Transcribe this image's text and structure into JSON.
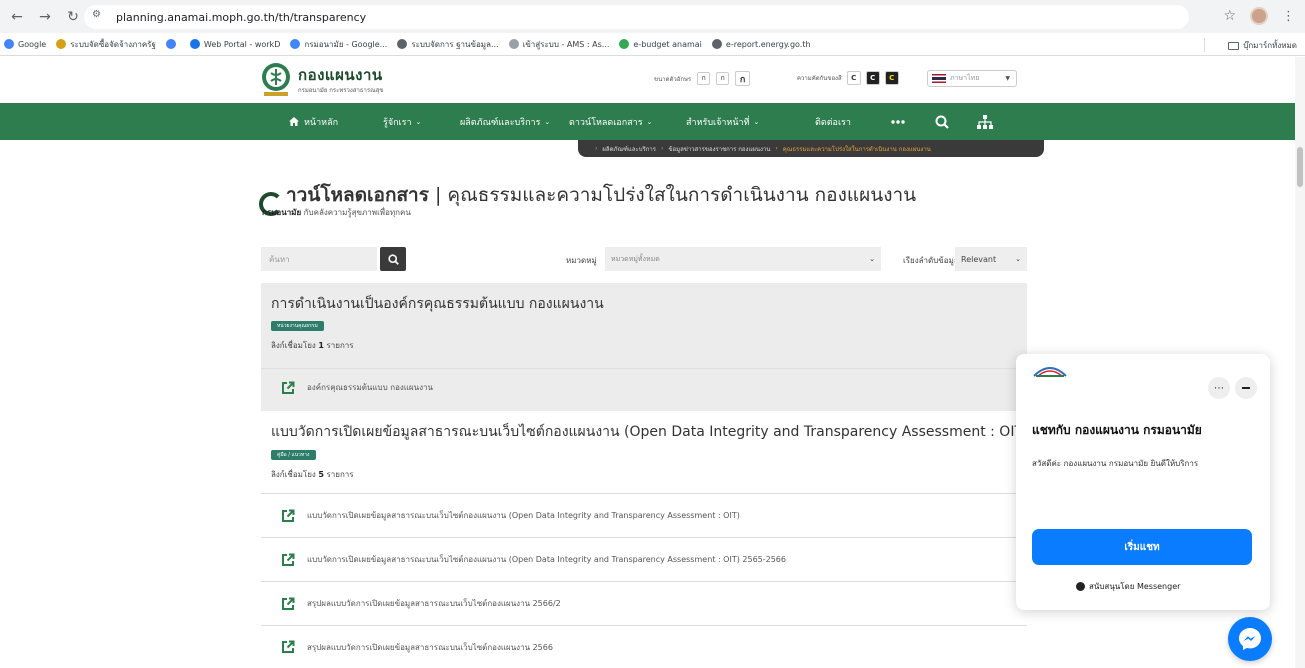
{
  "browser": {
    "url": "planning.anamai.moph.go.th/th/transparency",
    "bookmarks": [
      {
        "label": "Google",
        "color": "#4285f4"
      },
      {
        "label": "ระบบจัดซื้อจัดจ้างภาครัฐ",
        "color": "#d4a017"
      },
      {
        "label": "",
        "color": "#4285f4"
      },
      {
        "label": "Web Portal - workD",
        "color": "#1a73e8"
      },
      {
        "label": "กรมอนามัย - Google...",
        "color": "#4285f4"
      },
      {
        "label": "ระบบจัดการ ฐานข้อมูล...",
        "color": "#5f6368"
      },
      {
        "label": "เข้าสู่ระบบ - AMS : As...",
        "color": "#9aa0a6"
      },
      {
        "label": "e-budget anamai",
        "color": "#34a853"
      },
      {
        "label": "e-report.energy.go.th",
        "color": "#5f6368"
      }
    ],
    "bookmarks_right": "บุ๊กมาร์กทั้งหมด"
  },
  "header": {
    "logo_title": "กองแผนงาน",
    "logo_sub": "กรมอนามัย กระทรวงสาธารณสุข",
    "font_size_label": "ขนาดตัวอักษร",
    "font_btns": [
      "ก",
      "ก",
      "ก"
    ],
    "contrast_label": "ความคัดกันของสี",
    "contrast_btns": [
      "C",
      "C",
      "C"
    ],
    "language": "ภาษาไทย"
  },
  "nav": {
    "home": "หน้าหลัก",
    "about": "รู้จักเรา",
    "products": "ผลิตภัณฑ์และบริการ",
    "downloads": "ดาวน์โหลดเอกสาร",
    "staff": "สำหรับเจ้าหน้าที่",
    "contact": "ติดต่อเรา"
  },
  "breadcrumb": {
    "items": [
      "ผลิตภัณฑ์และบริการ",
      "ข้อมูลข่าวสารของราชการ กองแผนงาน"
    ],
    "current": "คุณธรรมและความโปร่งใสในการดำเนินงาน กองแผนงาน"
  },
  "page": {
    "title_bold": "าวน์โหลดเอกสาร",
    "title_rest": " | คุณธรรมและความโปร่งใสในการดำเนินงาน กองแผนงาน",
    "sub_bold": "กรมอนามัย",
    "sub_rest": " กับคลังความรู้สุขภาพเพื่อทุกคน"
  },
  "filters": {
    "search_placeholder": "ค้นหา",
    "category_label": "หมวดหมู่",
    "category_value": "หมวดหมู่ทั้งหมด",
    "sort_label": "เรียงลำดับข้อมูล",
    "sort_value": "Relevant"
  },
  "sections": [
    {
      "title": "การดำเนินงานเป็นองค์กรคุณธรรมต้นแบบ กองแผนงาน",
      "badge": "หน่วยงานคุณธรรม",
      "count_prefix": "ลิงก์เชื่อมโยง",
      "count": "1",
      "count_suffix": "รายการ",
      "links": [
        "องค์กรคุณธรรมต้นแบบ กองแผนงาน"
      ]
    },
    {
      "title": "แบบวัดการเปิดเผยข้อมูลสาธารณะบนเว็บไซต์กองแผนงาน (Open Data Integrity and Transparency Assessment : OIT)",
      "badge": "คู่มือ / แนวทาง",
      "count_prefix": "ลิงก์เชื่อมโยง",
      "count": "5",
      "count_suffix": "รายการ",
      "links": [
        "แบบวัดการเปิดเผยข้อมูลสาธารณะบนเว็บไซต์กองแผนงาน (Open Data Integrity and Transparency Assessment : OIT)",
        "แบบวัดการเปิดเผยข้อมูลสาธารณะบนเว็บไซต์กองแผนงาน (Open Data Integrity and Transparency Assessment : OIT) 2565-2566",
        "สรุปผลแบบวัดการเปิดเผยข้อมูลสาธารณะบนเว็บไซต์กองแผนงาน 2566/2",
        "สรุปผลแบบวัดการเปิดเผยข้อมูลสาธารณะบนเว็บไซต์กองแผนงาน 2566"
      ]
    }
  ],
  "chat": {
    "title": "แชทกับ กองแผนงาน กรมอนามัย",
    "message": "สวัสดีค่ะ กองแผนงาน กรมอนามัย ยินดีให้บริการ",
    "start_button": "เริ่มแชท",
    "powered_by": "สนับสนุนโดย Messenger"
  },
  "colors": {
    "nav_green": "#2e7d4f",
    "badge_teal": "#2e7d6a",
    "messenger_blue": "#0a7cff",
    "breadcrumb_accent": "#e8a23a"
  }
}
